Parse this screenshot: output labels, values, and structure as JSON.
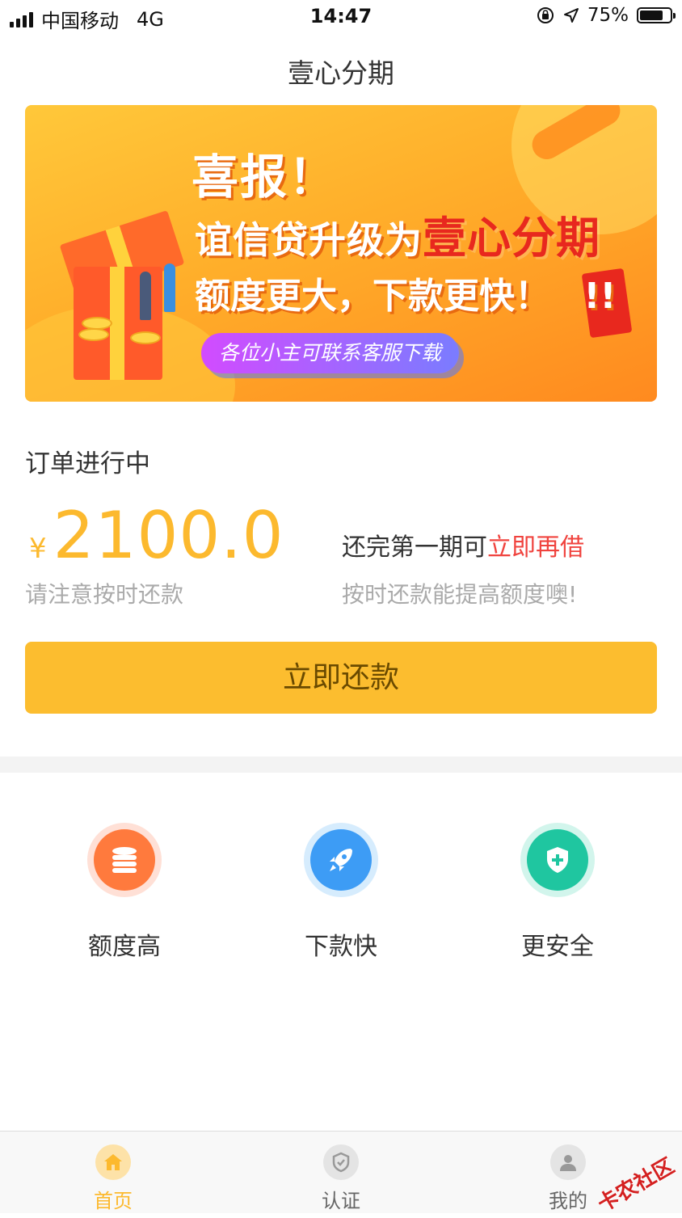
{
  "status_bar": {
    "carrier": "中国移动",
    "network": "4G",
    "time": "14:47",
    "battery": "75%"
  },
  "page_title": "壹心分期",
  "banner": {
    "headline": "喜报！",
    "line2_prefix": "谊信贷升级为",
    "line2_highlight": "壹心分期",
    "line3": "额度更大，下款更快！",
    "exclaim": "!!",
    "pill_text": "各位小主可联系客服下载"
  },
  "order": {
    "status": "订单进行中",
    "currency": "¥",
    "amount": "2100.0",
    "notice": "请注意按时还款",
    "reborrow_prefix": "还完第一期可",
    "reborrow_link": "立即再借",
    "tip": "按时还款能提高额度噢!"
  },
  "repay_button": "立即还款",
  "features": [
    {
      "label": "额度高",
      "icon": "coins-stack-icon",
      "color": "#ff7a3d"
    },
    {
      "label": "下款快",
      "icon": "rocket-icon",
      "color": "#3d9cf5"
    },
    {
      "label": "更安全",
      "icon": "shield-plus-icon",
      "color": "#1fc6a0"
    }
  ],
  "tabs": [
    {
      "label": "首页",
      "icon": "home-icon",
      "active": true
    },
    {
      "label": "认证",
      "icon": "shield-icon",
      "active": false
    },
    {
      "label": "我的",
      "icon": "user-icon",
      "active": false
    }
  ],
  "watermark": "卡农社区",
  "colors": {
    "accent": "#fcbd2f",
    "amount": "#fcb92e",
    "link": "#f0433e",
    "muted": "#aaaaaa",
    "tab_active": "#fcb92e",
    "tab_inactive": "#666666"
  }
}
